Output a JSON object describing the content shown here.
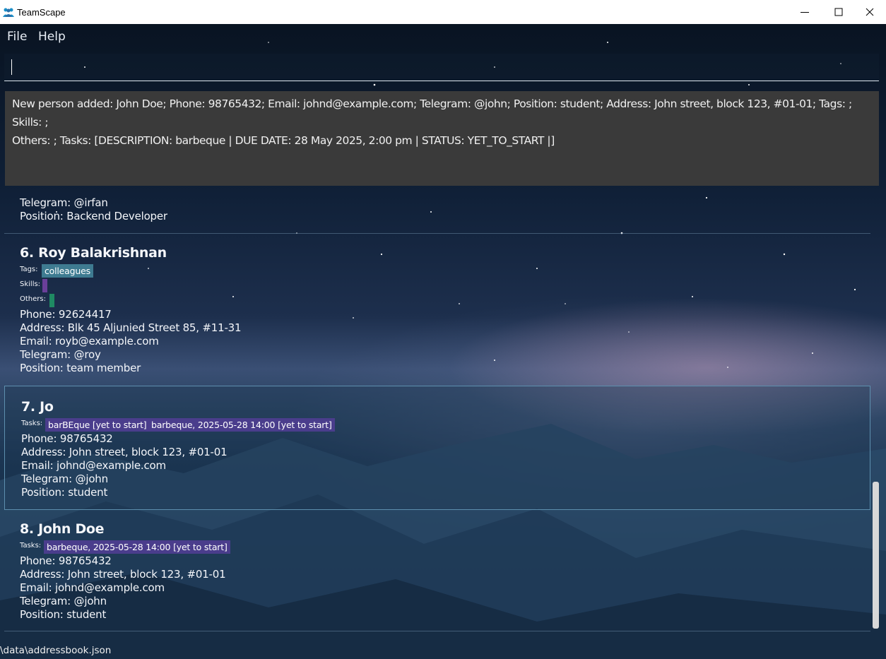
{
  "window": {
    "title": "TeamScape"
  },
  "menu": {
    "file": "File",
    "help": "Help"
  },
  "command_box": {
    "value": ""
  },
  "result": {
    "line1": "New person added: John Doe; Phone: 98765432; Email: johnd@example.com; Telegram: @john; Position: student; Address: John street, block 123, #01-01; Tags: ; Skills: ;",
    "line2": "Others: ; Tasks: [DESCRIPTION: barbeque | DUE DATE: 28 May 2025, 2:00 pm | STATUS: YET_TO_START |]"
  },
  "persons": {
    "p5": {
      "telegram": "Telegram: @irfan",
      "position": "Position: Backend Developer"
    },
    "p6": {
      "name": "6. Roy Balakrishnan",
      "tags_label": "Tags:",
      "tags": [
        "colleagues"
      ],
      "skills_label": "Skills:",
      "others_label": "Others:",
      "phone": "Phone: 92624417",
      "address": "Address: Blk 45 Aljunied Street 85, #11-31",
      "email": "Email: royb@example.com",
      "telegram": "Telegram: @roy",
      "position": "Position: team member"
    },
    "p7": {
      "name": "7. Jo",
      "tasks_label": "Tasks:",
      "tasks": [
        "barBEque [yet to start]",
        "barbeque, 2025-05-28 14:00 [yet to start]"
      ],
      "phone": "Phone: 98765432",
      "address": "Address: John street, block 123, #01-01",
      "email": "Email: johnd@example.com",
      "telegram": "Telegram: @john",
      "position": "Position: student"
    },
    "p8": {
      "name": "8. John Doe",
      "tasks_label": "Tasks:",
      "tasks": [
        "barbeque, 2025-05-28 14:00 [yet to start]"
      ],
      "phone": "Phone: 98765432",
      "address": "Address: John street, block 123, #01-01",
      "email": "Email: johnd@example.com",
      "telegram": "Telegram: @john",
      "position": "Position: student"
    }
  },
  "status_bar": {
    "path": "\\data\\addressbook.json"
  },
  "colors": {
    "tag_chip": "#3e7b91",
    "task_chip": "#4a3d8c",
    "skills_bar": "#6a3f99",
    "others_bar": "#1f8a63",
    "result_bg": "#3a3a3a"
  },
  "icons": {
    "app": "team-icon",
    "minimize": "minimize-icon",
    "maximize": "maximize-icon",
    "close": "close-icon"
  }
}
